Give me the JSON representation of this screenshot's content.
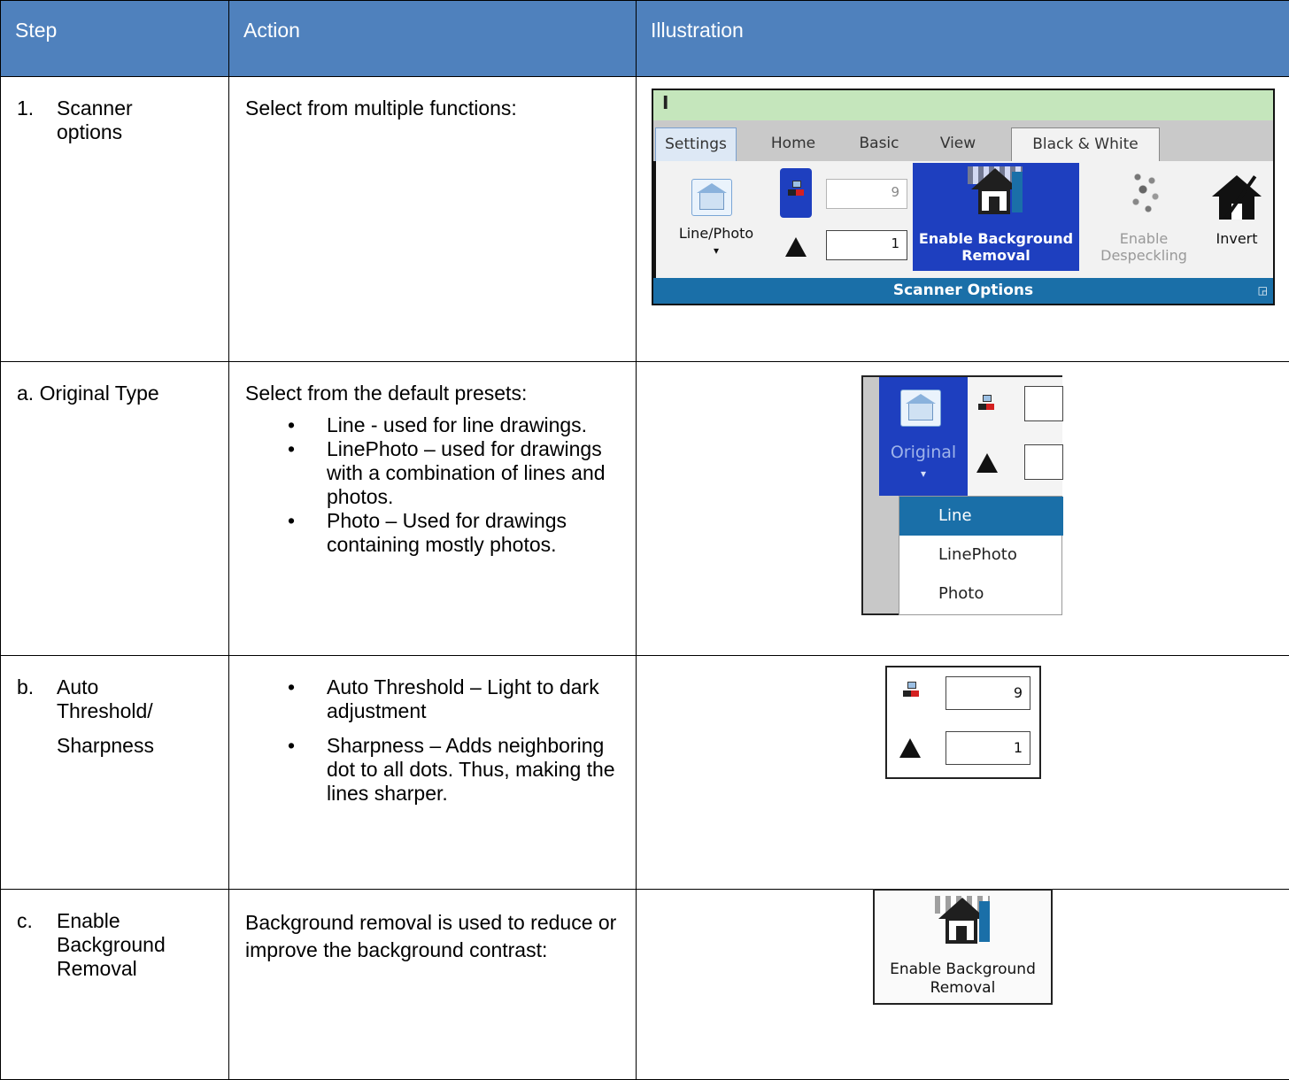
{
  "table": {
    "headers": {
      "step": "Step",
      "action": "Action",
      "illustration": "Illustration"
    },
    "rows": [
      {
        "num": "1.",
        "step": "Scanner options",
        "action": "Select from multiple functions:"
      },
      {
        "step": "a. Original Type",
        "action_intro": "Select from the default presets:",
        "bullets": [
          "Line - used for line drawings.",
          "LinePhoto – used for drawings with a combination of lines and photos.",
          "Photo – Used for drawings containing mostly photos."
        ]
      },
      {
        "num": "b.",
        "step_line1": "Auto Threshold/",
        "step_line2": "Sharpness",
        "bullets": [
          "Auto Threshold – Light to dark adjustment",
          "Sharpness – Adds neighboring dot to all dots. Thus, making the lines sharper."
        ]
      },
      {
        "num": "c.",
        "step": "Enable Background Removal",
        "action": "Background removal is used to reduce or improve the background contrast:"
      }
    ]
  },
  "ribbon": {
    "title_glyph": "I",
    "tabs": [
      "Settings",
      "Home",
      "Basic",
      "View",
      "Black & White"
    ],
    "active_tab": "Black & White",
    "line_photo_label": "Line/Photo",
    "dropdown_arrow": "▾",
    "threshold_value": "9",
    "sharpness_value": "1",
    "bg_removal_label_1": "Enable Background",
    "bg_removal_label_2": "Removal",
    "despeckle_label_1": "Enable",
    "despeckle_label_2": "Despeckling",
    "invert_label": "Invert",
    "group_label": "Scanner Options",
    "group_corner": "◲"
  },
  "original_menu": {
    "button_label": "Original",
    "arrow": "▾",
    "options": [
      "Line",
      "LinePhoto",
      "Photo"
    ],
    "selected": "Line"
  },
  "threshold_widget": {
    "threshold_value": "9",
    "sharpness_value": "1"
  },
  "bg_button": {
    "label_1": "Enable Background",
    "label_2": "Removal"
  },
  "colors": {
    "header_bg": "#4f81bd",
    "ribbon_accent": "#1a6fa8",
    "selected_blue": "#1e3fbf"
  }
}
